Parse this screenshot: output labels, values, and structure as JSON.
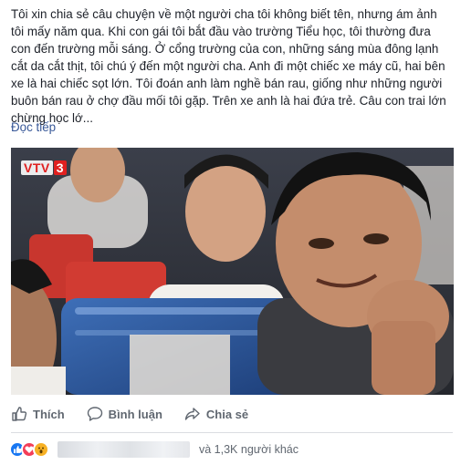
{
  "post": {
    "text": "Tôi xin chia sẻ câu chuyện về một người cha tôi không biết tên, nhưng ám ảnh tôi mấy năm qua. Khi con gái tôi bắt đầu vào trường Tiểu học, tôi thường đưa con đến trường mỗi sáng. Ở cổng trường của con, những sáng mùa đông lạnh cắt da cắt thịt, tôi chú ý đến một người cha. Anh đi một chiếc xe máy cũ, hai bên xe là hai chiếc sọt lớn. Tôi đoán anh làm nghề bán rau, giống như những người buôn bán rau ở chợ đầu mối tôi gặp. Trên xe anh là hai đứa trẻ. Câu con trai lớn chừng học lớ...",
    "see_more": "Đọc tiếp"
  },
  "photo": {
    "channel_logo_main": "VTV",
    "channel_logo_num": "3"
  },
  "actions": {
    "like": "Thích",
    "comment": "Bình luận",
    "share": "Chia sẻ"
  },
  "reactions": {
    "others_text": "và 1,3K người khác"
  },
  "colors": {
    "link": "#385898",
    "action_text": "#606770",
    "like_blue": "#1877f2",
    "love_red": "#f33e58",
    "wow_yellow": "#f7b125"
  }
}
